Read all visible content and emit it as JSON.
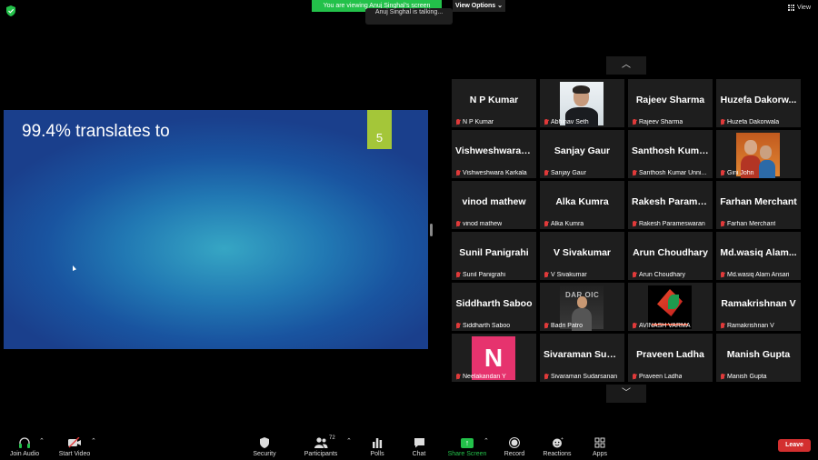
{
  "top": {
    "banner": "You are viewing Anuj Singhal's screen",
    "talking": "Anuj Singhal is talking...",
    "view_options": "View Options ⌄",
    "view": "View"
  },
  "shared_screen": {
    "title": "99.4% translates to",
    "slide_number": "5"
  },
  "gallery": {
    "rows": [
      [
        {
          "big": "N P Kumar",
          "label": "N P Kumar"
        },
        {
          "big": "",
          "label": "Abhinav Seth",
          "video": "man"
        },
        {
          "big": "Rajeev Sharma",
          "label": "Rajeev Sharma"
        },
        {
          "big": "Huzefa Dakorw...",
          "label": "Huzefa Dakorwala"
        }
      ],
      [
        {
          "big": "Vishweshwara K...",
          "label": "Vishweshwara Karkala"
        },
        {
          "big": "Sanjay Gaur",
          "label": "Sanjay Gaur"
        },
        {
          "big": "Santhosh Kuma...",
          "label": "Santhosh Kumar Unni..."
        },
        {
          "big": "",
          "label": "Gini John",
          "video": "family"
        }
      ],
      [
        {
          "big": "vinod mathew",
          "label": "vinod mathew"
        },
        {
          "big": "Alka Kumra",
          "label": "Alka Kumra"
        },
        {
          "big": "Rakesh Parames...",
          "label": "Rakesh Parameswaran"
        },
        {
          "big": "Farhan Merchant",
          "label": "Farhan Merchant"
        }
      ],
      [
        {
          "big": "Sunil Panigrahi",
          "label": "Sunil Panigrahi"
        },
        {
          "big": "V Sivakumar",
          "label": "V Sivakumar"
        },
        {
          "big": "Arun Choudhary",
          "label": "Arun Choudhary"
        },
        {
          "big": "Md.wasiq Alam...",
          "label": "Md.wasiq Alam Ansari"
        }
      ],
      [
        {
          "big": "Siddharth Saboo",
          "label": "Siddharth Saboo"
        },
        {
          "big": "",
          "label": "Badri Patro",
          "video": "speaker",
          "logo_text": "DAR OIC"
        },
        {
          "big": "",
          "label": "AVINASH VARMA",
          "video": "logo"
        },
        {
          "big": "Ramakrishnan V",
          "label": "Ramakrishnan V"
        }
      ],
      [
        {
          "big": "",
          "label": "Neelakandan Y",
          "avatar": "N"
        },
        {
          "big": "Sivaraman Suda...",
          "label": "Sivaraman Sudarsanan"
        },
        {
          "big": "Praveen Ladha",
          "label": "Praveen Ladha"
        },
        {
          "big": "Manish Gupta",
          "label": "Manish Gupta"
        }
      ]
    ]
  },
  "toolbar": {
    "join_audio": "Join Audio",
    "start_video": "Start Video",
    "security": "Security",
    "participants": "Participants",
    "participants_count": "72",
    "polls": "Polls",
    "chat": "Chat",
    "share_screen": "Share Screen",
    "record": "Record",
    "reactions": "Reactions",
    "apps": "Apps",
    "leave": "Leave"
  },
  "colors": {
    "share_green": "#23c14a",
    "leave_red": "#d32f2f",
    "muted_red": "#e03a3a",
    "slide_accent": "#a4c639"
  },
  "icons": [
    "shield-icon",
    "grid-view-icon",
    "chevron-up-icon",
    "chevron-down-icon",
    "muted-mic-icon",
    "headphones-icon",
    "video-off-icon",
    "security-icon",
    "participants-icon",
    "polls-icon",
    "chat-icon",
    "share-screen-icon",
    "record-icon",
    "reactions-icon",
    "apps-icon"
  ]
}
